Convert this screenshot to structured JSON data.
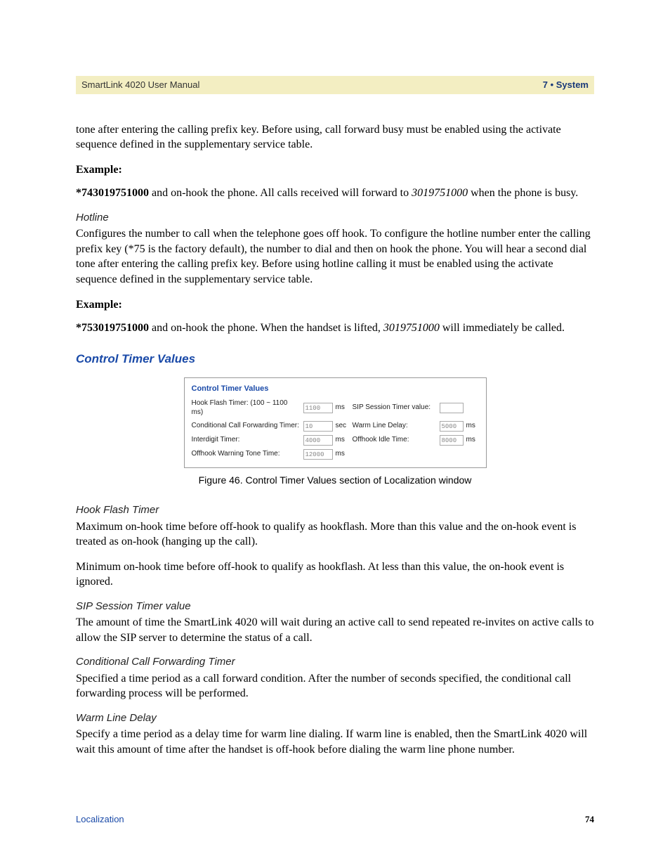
{
  "header": {
    "left": "SmartLink 4020 User Manual",
    "right": "7 • System"
  },
  "intro_continuation": "tone after entering the calling prefix key. Before using, call forward busy must be enabled using the activate sequence defined in the supplementary service table.",
  "example_label": "Example:",
  "example1": {
    "code": "*743019751000",
    "mid": " and on-hook the phone. All calls received will forward to ",
    "num": "3019751000",
    "tail": " when the phone is busy."
  },
  "hotline": {
    "heading": "Hotline",
    "body": "Configures the number to call when the telephone goes off hook. To configure the hotline number enter the calling prefix key (*75 is the factory default), the number to dial and then on hook the phone. You will hear a second dial tone after entering the calling prefix key. Before using hotline calling it must be enabled using the activate sequence defined in the supplementary service table."
  },
  "example2": {
    "code": "*753019751000",
    "mid": " and on-hook the phone. When the handset is lifted, ",
    "num": "3019751000",
    "tail": " will immediately be called."
  },
  "section_title": "Control Timer Values",
  "figure": {
    "box_title": "Control Timer Values",
    "rows": [
      {
        "ll": "Hook Flash Timer: (100 ~ 1100 ms)",
        "lv": "1100",
        "lu": "ms",
        "rl": "SIP Session Timer value:",
        "rv": "",
        "ru": ""
      },
      {
        "ll": "Conditional Call Forwarding Timer:",
        "lv": "10",
        "lu": "sec",
        "rl": "Warm Line Delay:",
        "rv": "5000",
        "ru": "ms"
      },
      {
        "ll": "Interdigit Timer:",
        "lv": "4000",
        "lu": "ms",
        "rl": "Offhook Idle Time:",
        "rv": "8000",
        "ru": "ms"
      },
      {
        "ll": "Offhook Warning Tone Time:",
        "lv": "12000",
        "lu": "ms",
        "rl": "",
        "rv": "",
        "ru": ""
      }
    ],
    "caption": "Figure 46. Control Timer Values section of Localization window"
  },
  "subsections": {
    "hookflash": {
      "heading": "Hook Flash Timer",
      "p1": "Maximum on-hook time before off-hook to qualify as hookflash. More than this value and the on-hook event is treated as on-hook (hanging up the call).",
      "p2": "Minimum on-hook time before off-hook to qualify as hookflash. At less than this value, the on-hook event is ignored."
    },
    "sip": {
      "heading": "SIP Session Timer value",
      "body": "The amount of time the SmartLink 4020 will wait during an active call to send repeated re-invites on active calls to allow the SIP server to determine the status of a call."
    },
    "ccf": {
      "heading": "Conditional Call Forwarding Timer",
      "body": "Specified a time period as a call forward condition. After the number of seconds specified, the conditional call forwarding process will be performed."
    },
    "warm": {
      "heading": "Warm Line Delay",
      "body": "Specify a time period as a delay time for warm line dialing. If warm line is enabled, then the SmartLink 4020 will wait this amount of time after the handset is off-hook before dialing the warm line phone number."
    }
  },
  "footer": {
    "left": "Localization",
    "right": "74"
  }
}
